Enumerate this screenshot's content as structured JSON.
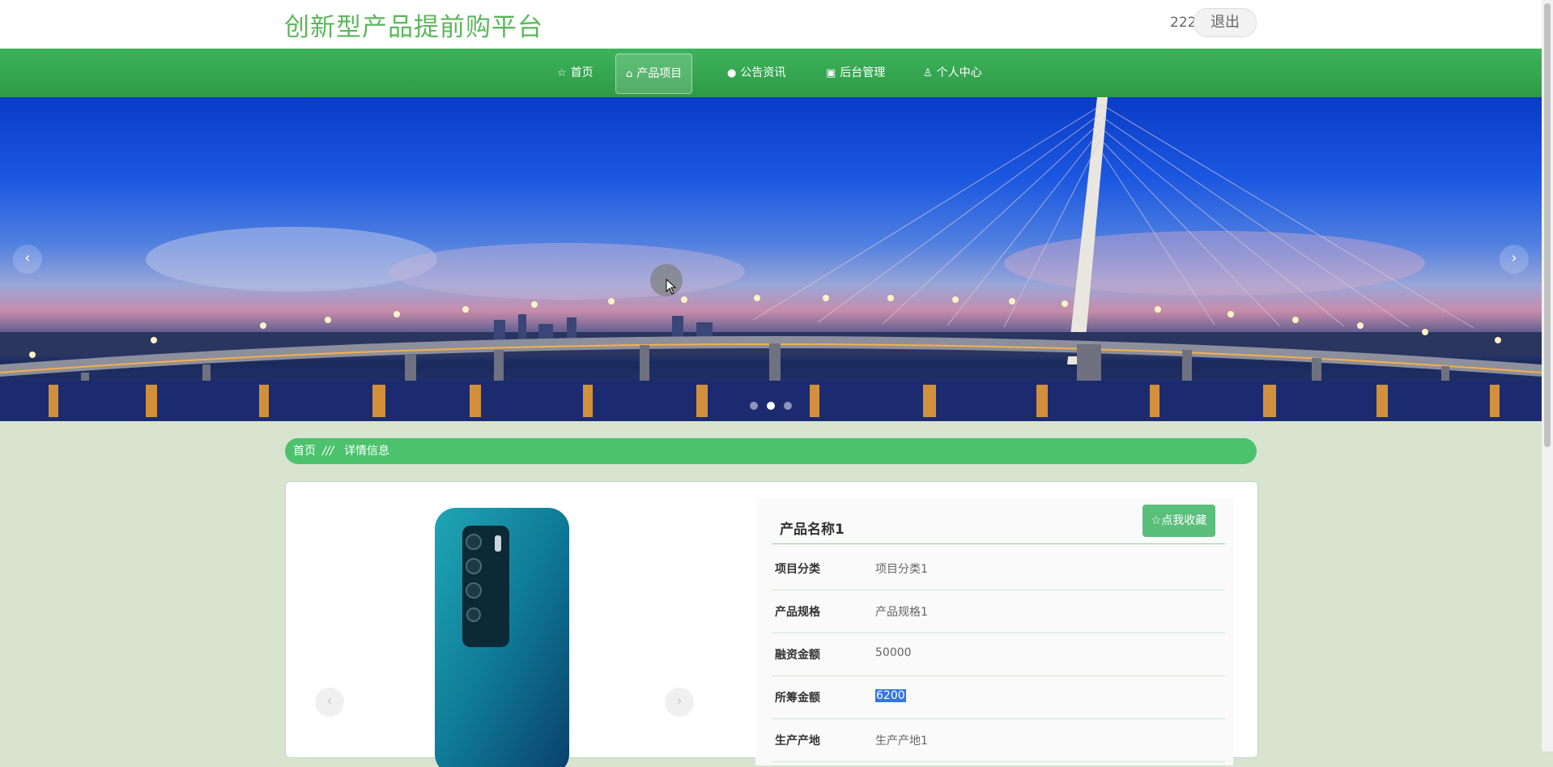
{
  "header": {
    "site_title": "创新型产品提前购平台",
    "username": "222",
    "logout_label": "退出"
  },
  "nav": {
    "items": [
      {
        "label": "首页",
        "icon": "star-icon"
      },
      {
        "label": "产品项目",
        "icon": "bag-icon"
      },
      {
        "label": "公告资讯",
        "icon": "info-icon"
      },
      {
        "label": "后台管理",
        "icon": "box-icon"
      },
      {
        "label": "个人中心",
        "icon": "user-icon"
      }
    ],
    "active_index": 1
  },
  "banner": {
    "prev_label": "‹",
    "next_label": "›",
    "active_dot": 1
  },
  "breadcrumb": {
    "home": "首页",
    "separator": "///",
    "current": "详情信息"
  },
  "product": {
    "name": "产品名称1",
    "favorite_label": "☆点我收藏",
    "image_prev": "‹",
    "image_next": "›",
    "fields": [
      {
        "label": "项目分类",
        "value": "项目分类1"
      },
      {
        "label": "产品规格",
        "value": "产品规格1"
      },
      {
        "label": "融资金额",
        "value": "50000"
      },
      {
        "label": "所筹金额",
        "value": "6200"
      },
      {
        "label": "生产产地",
        "value": "生产产地1"
      }
    ]
  },
  "colors": {
    "brand_green": "#5bb75b",
    "nav_green": "#2f9a45",
    "breadcrumb_green": "#4cc26d",
    "button_green": "#5bbf7c"
  }
}
